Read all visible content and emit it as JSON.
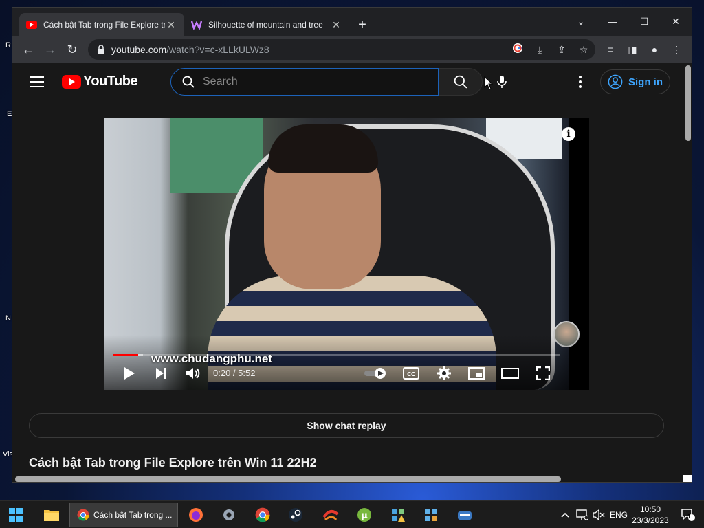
{
  "desktop": {
    "labels": [
      "R",
      "E",
      "N",
      "Vis"
    ]
  },
  "browser": {
    "tabs": [
      {
        "title": "Cách bật Tab trong File Explore tr",
        "favicon": "youtube-icon"
      },
      {
        "title": "Silhouette of mountain and tree",
        "favicon": "w-logo-icon"
      }
    ],
    "url_host": "youtube.com",
    "url_path": "/watch?v=c-xLLkULWz8"
  },
  "youtube": {
    "logo_text": "YouTube",
    "search_placeholder": "Search",
    "sign_in_label": "Sign in",
    "video": {
      "watermark": "www.chudangphu.net",
      "time_current": "0:20",
      "time_total": "5:52",
      "progress": 0.057
    },
    "chat_replay_label": "Show chat replay",
    "video_title": "Cách bật Tab trong File Explore trên Win 11 22H2"
  },
  "taskbar": {
    "active_app_title": "Cách bật Tab trong ...",
    "language": "ENG",
    "time": "10:50",
    "date": "23/3/2023",
    "notification_count": "1"
  },
  "colors": {
    "youtube_red": "#ff0000",
    "link_blue": "#3ea6ff",
    "search_focus": "#1c62b9"
  }
}
